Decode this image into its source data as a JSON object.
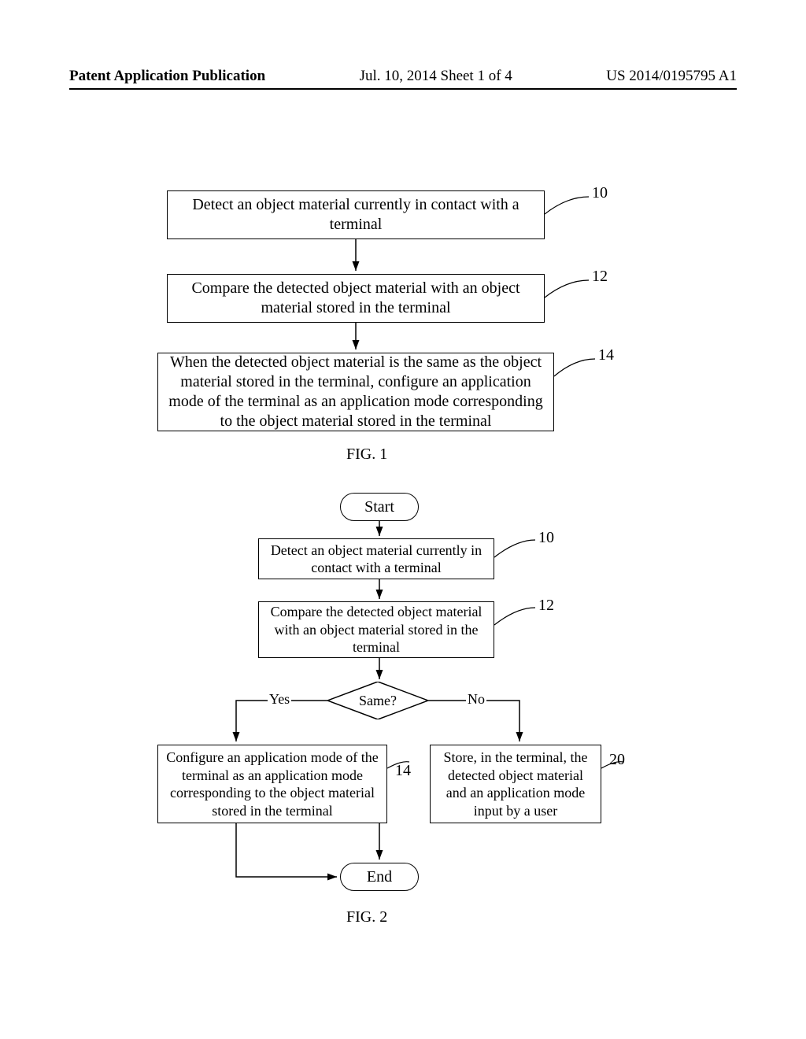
{
  "header": {
    "left": "Patent Application Publication",
    "mid": "Jul. 10, 2014  Sheet 1 of 4",
    "right": "US 2014/0195795 A1"
  },
  "fig1": {
    "caption": "FIG. 1",
    "box1": {
      "text": "Detect an object material currently in contact with a terminal",
      "num": "10"
    },
    "box2": {
      "text": "Compare the detected object material with an object material stored in the terminal",
      "num": "12"
    },
    "box3": {
      "text": "When the detected object material is the same as the object material stored in the terminal, configure an application mode of the terminal as an application mode corresponding to the object material stored in the terminal",
      "num": "14"
    }
  },
  "fig2": {
    "caption": "FIG. 2",
    "start": "Start",
    "end": "End",
    "box1": {
      "text": "Detect an object material currently in contact with a terminal",
      "num": "10"
    },
    "box2": {
      "text": "Compare the detected object material with an object material stored in the terminal",
      "num": "12"
    },
    "decision": {
      "text": "Same?",
      "yes": "Yes",
      "no": "No"
    },
    "box3": {
      "text": "Configure an application mode of the terminal as an application mode corresponding to the object material stored in the terminal",
      "num": "14"
    },
    "box4": {
      "text": "Store, in the terminal, the detected object material and an application mode input by a user",
      "num": "20"
    }
  },
  "chart_data": [
    {
      "type": "flowchart",
      "title": "FIG. 1",
      "nodes": [
        {
          "id": "10",
          "type": "process",
          "text": "Detect an object material currently in contact with a terminal"
        },
        {
          "id": "12",
          "type": "process",
          "text": "Compare the detected object material with an object material stored in the terminal"
        },
        {
          "id": "14",
          "type": "process",
          "text": "When the detected object material is the same as the object material stored in the terminal, configure an application mode of the terminal as an application mode corresponding to the object material stored in the terminal"
        }
      ],
      "edges": [
        {
          "from": "10",
          "to": "12"
        },
        {
          "from": "12",
          "to": "14"
        }
      ]
    },
    {
      "type": "flowchart",
      "title": "FIG. 2",
      "nodes": [
        {
          "id": "start",
          "type": "terminator",
          "text": "Start"
        },
        {
          "id": "10",
          "type": "process",
          "text": "Detect an object material currently in contact with a terminal"
        },
        {
          "id": "12",
          "type": "process",
          "text": "Compare the detected object material with an object material stored in the terminal"
        },
        {
          "id": "d",
          "type": "decision",
          "text": "Same?"
        },
        {
          "id": "14",
          "type": "process",
          "text": "Configure an application mode of the terminal as an application mode corresponding to the object material stored in the terminal"
        },
        {
          "id": "20",
          "type": "process",
          "text": "Store, in the terminal, the detected object material and an application mode input by a user"
        },
        {
          "id": "end",
          "type": "terminator",
          "text": "End"
        }
      ],
      "edges": [
        {
          "from": "start",
          "to": "10"
        },
        {
          "from": "10",
          "to": "12"
        },
        {
          "from": "12",
          "to": "d"
        },
        {
          "from": "d",
          "to": "14",
          "label": "Yes"
        },
        {
          "from": "d",
          "to": "20",
          "label": "No"
        },
        {
          "from": "14",
          "to": "end"
        },
        {
          "from": "20",
          "to": "end"
        }
      ]
    }
  ]
}
